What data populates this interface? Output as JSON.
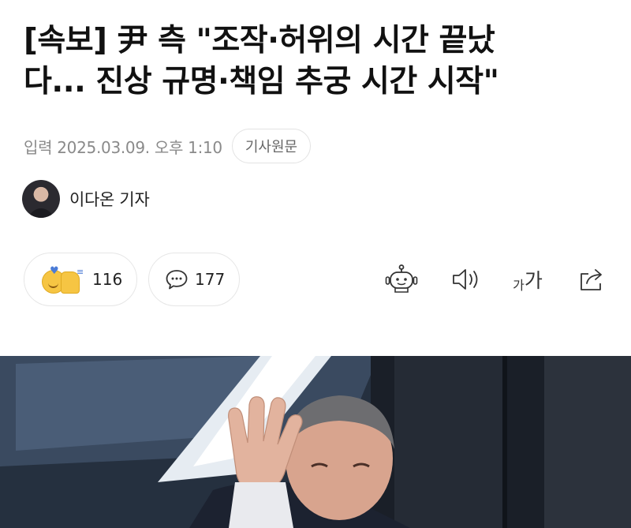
{
  "article": {
    "headline_line1": "[속보] 尹 측 \"조작·허위의 시간 끝났",
    "headline_line2": "다... 진상 규명·책임 추궁 시간 시작\"",
    "published": "입력 2025.03.09. 오후 1:10",
    "original_button": "기사원문"
  },
  "author": {
    "name": "이다온 기자"
  },
  "actions": {
    "reaction_count": "116",
    "comment_count": "177",
    "font_small": "가",
    "font_large": "가"
  },
  "icons": {
    "reaction": "emoji-reaction-icon",
    "comment": "speech-bubble-icon",
    "summary_bot": "robot-icon",
    "listen": "speaker-icon",
    "font_size": "font-size-icon",
    "share": "share-icon"
  },
  "colors": {
    "headline": "#111111",
    "meta_gray": "#8a8a8a",
    "border": "#e6e6e6"
  }
}
